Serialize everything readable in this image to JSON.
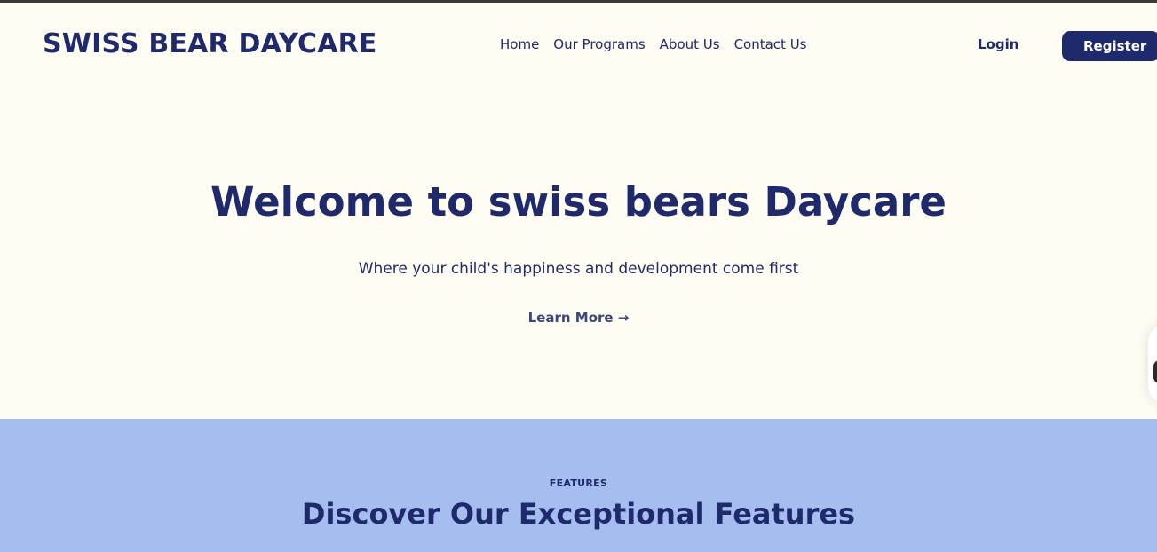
{
  "header": {
    "brand": "SWISS BEAR DAYCARE",
    "nav": [
      {
        "label": "Home"
      },
      {
        "label": "Our Programs"
      },
      {
        "label": "About Us"
      },
      {
        "label": "Contact Us"
      }
    ],
    "login_label": "Login",
    "register_label": "Register"
  },
  "hero": {
    "title": "Welcome to swiss bears Daycare",
    "subtitle": "Where your child's happiness and development come first",
    "cta_label": "Learn More →"
  },
  "features": {
    "eyebrow": "FEATURES",
    "title": "Discover Our Exceptional Features"
  },
  "colors": {
    "background": "#fffcf3",
    "primary": "#1e2a6b",
    "features_background": "#a6bdf0"
  }
}
